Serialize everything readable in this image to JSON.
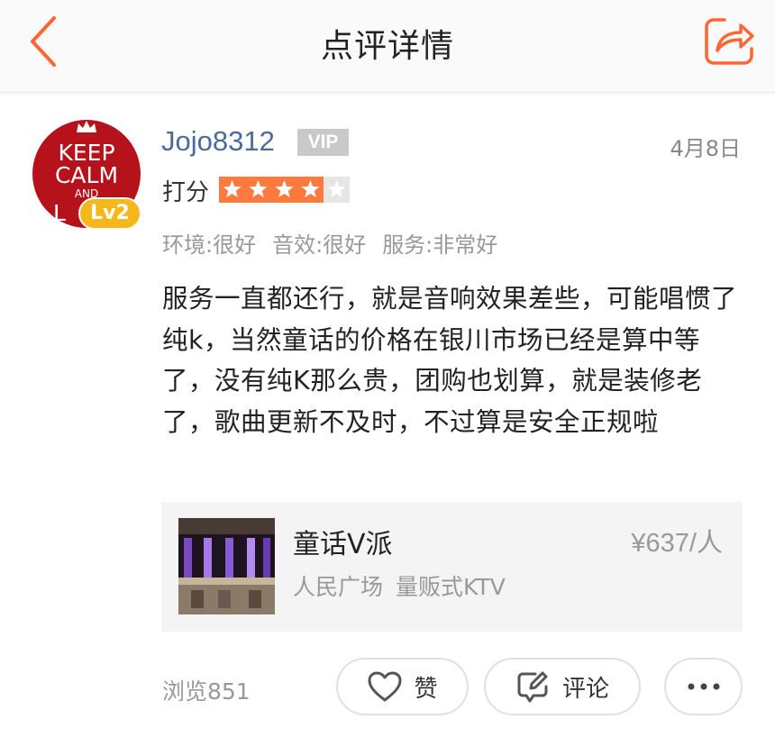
{
  "header": {
    "title": "点评详情",
    "back_icon": "chevron-left-icon",
    "share_icon": "share-icon",
    "accent": "#ff6633"
  },
  "user": {
    "name": "Jojo8312",
    "vip_label": "VIP",
    "level": "Lv2",
    "avatar_text": [
      "KEEP",
      "CALM",
      "AND",
      "L"
    ],
    "date": "4月8日"
  },
  "rating": {
    "label": "打分",
    "stars": 4,
    "max": 5,
    "star_color": "#ff7a3c"
  },
  "subscores": [
    "环境:很好",
    "音效:很好",
    "服务:非常好"
  ],
  "review": {
    "text": "服务一直都还行，就是音响效果差些，可能唱惯了纯k，当然童话的价格在银川市场已经是算中等了，没有纯K那么贵，团购也划算，就是装修老了，歌曲更新不及时，不过算是安全正规啦"
  },
  "shop": {
    "name": "童话V派",
    "price": "¥637/人",
    "location": "人民广场",
    "category": "量贩式KTV"
  },
  "footer": {
    "views": "浏览851",
    "like_label": "赞",
    "comment_label": "评论",
    "more_icon": "more-icon"
  }
}
